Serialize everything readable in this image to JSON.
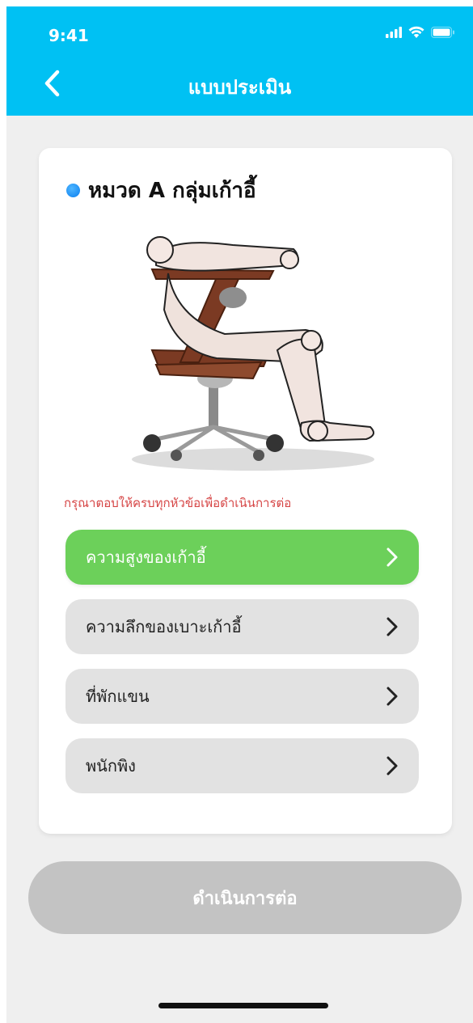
{
  "status_bar": {
    "time": "9:41"
  },
  "nav": {
    "title": "แบบประเมิน",
    "back_icon": "chevron-left-icon"
  },
  "section": {
    "title": "หมวด A กลุ่มเก้าอี้",
    "illustration": "chair-with-mannequin"
  },
  "warning_text": "กรุณาตอบให้ครบทุกหัวข้อเพื่อดำเนินการต่อ",
  "options": [
    {
      "label": "ความสูงของเก้าอี้",
      "active": true
    },
    {
      "label": "ความลึกของเบาะเก้าอี้",
      "active": false
    },
    {
      "label": "ที่พักแขน",
      "active": false
    },
    {
      "label": "พนักพิง",
      "active": false
    }
  ],
  "continue_button": {
    "label": "ดำเนินการต่อ"
  },
  "colors": {
    "header": "#00c1f3",
    "active_option": "#6cd05a",
    "inactive_option": "#e2e2e2",
    "warning": "#d64545",
    "disabled_button": "#c3c3c3",
    "dot": "#0a7ff0"
  }
}
